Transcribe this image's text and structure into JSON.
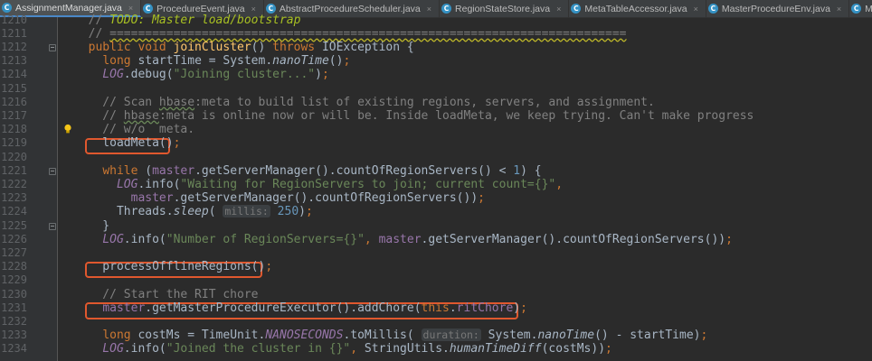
{
  "tabs": [
    {
      "label": "AssignmentManager.java",
      "active": true
    },
    {
      "label": "ProcedureEvent.java",
      "active": false
    },
    {
      "label": "AbstractProcedureScheduler.java",
      "active": false
    },
    {
      "label": "RegionStateStore.java",
      "active": false
    },
    {
      "label": "MetaTableAccessor.java",
      "active": false
    },
    {
      "label": "MasterProcedureEnv.java",
      "active": false
    },
    {
      "label": "MasterRpcServices.java",
      "active": false
    }
  ],
  "tab_icon_letter": "C",
  "lines": [
    {
      "num": "1210",
      "segs": [
        {
          "t": "  // ",
          "c": "cmt"
        },
        {
          "t": "TODO: Master load/bootstrap",
          "c": "todo"
        }
      ]
    },
    {
      "num": "1211",
      "segs": [
        {
          "t": "  // ",
          "c": "cmt"
        },
        {
          "t": "=========================================================================",
          "c": "dline"
        }
      ]
    },
    {
      "num": "1212",
      "segs": [
        {
          "t": "  ",
          "c": ""
        },
        {
          "t": "public void ",
          "c": "kw"
        },
        {
          "t": "joinCluster",
          "c": "fn"
        },
        {
          "t": "() ",
          "c": ""
        },
        {
          "t": "throws ",
          "c": "kw"
        },
        {
          "t": "IOException {",
          "c": ""
        }
      ]
    },
    {
      "num": "1213",
      "segs": [
        {
          "t": "    ",
          "c": ""
        },
        {
          "t": "long ",
          "c": "kw"
        },
        {
          "t": "startTime = System.",
          "c": ""
        },
        {
          "t": "nanoTime",
          "c": "itl"
        },
        {
          "t": "()",
          "c": ""
        },
        {
          "t": ";",
          "c": "kw"
        }
      ]
    },
    {
      "num": "1214",
      "segs": [
        {
          "t": "    ",
          "c": ""
        },
        {
          "t": "LOG",
          "c": "sfi"
        },
        {
          "t": ".debug(",
          "c": ""
        },
        {
          "t": "\"Joining cluster...\"",
          "c": "str"
        },
        {
          "t": ")",
          "c": ""
        },
        {
          "t": ";",
          "c": "kw"
        }
      ]
    },
    {
      "num": "1215",
      "segs": []
    },
    {
      "num": "1216",
      "segs": [
        {
          "t": "    // Scan ",
          "c": "cmt"
        },
        {
          "t": "hbase",
          "c": "cmt squig"
        },
        {
          "t": ":meta to build list of existing regions, servers, and assignment.",
          "c": "cmt"
        }
      ]
    },
    {
      "num": "1217",
      "segs": [
        {
          "t": "    // ",
          "c": "cmt"
        },
        {
          "t": "hbase",
          "c": "cmt squig"
        },
        {
          "t": ":meta is online now or will be. Inside loadMeta, we keep trying. Can't make progress",
          "c": "cmt"
        }
      ]
    },
    {
      "num": "1218",
      "segs": [
        {
          "t": "    // w/o  meta.",
          "c": "cmt"
        }
      ]
    },
    {
      "num": "1219",
      "segs": [
        {
          "t": "    loadMeta()",
          "c": ""
        },
        {
          "t": ";",
          "c": "kw"
        }
      ]
    },
    {
      "num": "1220",
      "segs": []
    },
    {
      "num": "1221",
      "segs": [
        {
          "t": "    ",
          "c": ""
        },
        {
          "t": "while ",
          "c": "kw"
        },
        {
          "t": "(",
          "c": ""
        },
        {
          "t": "master",
          "c": "fld"
        },
        {
          "t": ".getServerManager().countOfRegionServers() < ",
          "c": ""
        },
        {
          "t": "1",
          "c": "num"
        },
        {
          "t": ") {",
          "c": ""
        }
      ]
    },
    {
      "num": "1222",
      "segs": [
        {
          "t": "      ",
          "c": ""
        },
        {
          "t": "LOG",
          "c": "sfi"
        },
        {
          "t": ".info(",
          "c": ""
        },
        {
          "t": "\"Waiting for RegionServers to join; current count={}\"",
          "c": "str"
        },
        {
          "t": ",",
          "c": "kw"
        }
      ]
    },
    {
      "num": "1223",
      "segs": [
        {
          "t": "        ",
          "c": ""
        },
        {
          "t": "master",
          "c": "fld"
        },
        {
          "t": ".getServerManager().countOfRegionServers())",
          "c": ""
        },
        {
          "t": ";",
          "c": "kw"
        }
      ]
    },
    {
      "num": "1224",
      "segs": [
        {
          "t": "      Threads.",
          "c": ""
        },
        {
          "t": "sleep",
          "c": "itl"
        },
        {
          "t": "( ",
          "c": ""
        },
        {
          "t": "millis:",
          "c": "hint"
        },
        {
          "t": " ",
          "c": ""
        },
        {
          "t": "250",
          "c": "num"
        },
        {
          "t": ")",
          "c": ""
        },
        {
          "t": ";",
          "c": "kw"
        }
      ]
    },
    {
      "num": "1225",
      "segs": [
        {
          "t": "    }",
          "c": ""
        }
      ]
    },
    {
      "num": "1226",
      "segs": [
        {
          "t": "    ",
          "c": ""
        },
        {
          "t": "LOG",
          "c": "sfi"
        },
        {
          "t": ".info(",
          "c": ""
        },
        {
          "t": "\"Number of RegionServers={}\"",
          "c": "str"
        },
        {
          "t": ", ",
          "c": "kw"
        },
        {
          "t": "master",
          "c": "fld"
        },
        {
          "t": ".getServerManager().countOfRegionServers())",
          "c": ""
        },
        {
          "t": ";",
          "c": "kw"
        }
      ]
    },
    {
      "num": "1227",
      "segs": []
    },
    {
      "num": "1228",
      "segs": [
        {
          "t": "    processOfflineRegions()",
          "c": ""
        },
        {
          "t": ";",
          "c": "kw"
        }
      ]
    },
    {
      "num": "1229",
      "segs": []
    },
    {
      "num": "1230",
      "segs": [
        {
          "t": "    // Start the RIT chore",
          "c": "cmt"
        }
      ]
    },
    {
      "num": "1231",
      "segs": [
        {
          "t": "    ",
          "c": ""
        },
        {
          "t": "master",
          "c": "fld"
        },
        {
          "t": ".getMasterProcedureExecutor().addChore(",
          "c": ""
        },
        {
          "t": "this",
          "c": "kw"
        },
        {
          "t": ".",
          "c": ""
        },
        {
          "t": "ritChore",
          "c": "fld"
        },
        {
          "t": ")",
          "c": ""
        },
        {
          "t": ";",
          "c": "kw"
        }
      ]
    },
    {
      "num": "1232",
      "segs": []
    },
    {
      "num": "1233",
      "segs": [
        {
          "t": "    ",
          "c": ""
        },
        {
          "t": "long ",
          "c": "kw"
        },
        {
          "t": "costMs = TimeUnit.",
          "c": ""
        },
        {
          "t": "NANOSECONDS",
          "c": "sfi"
        },
        {
          "t": ".toMillis( ",
          "c": ""
        },
        {
          "t": "duration:",
          "c": "hint"
        },
        {
          "t": " System.",
          "c": ""
        },
        {
          "t": "nanoTime",
          "c": "itl"
        },
        {
          "t": "() - startTime)",
          "c": ""
        },
        {
          "t": ";",
          "c": "kw"
        }
      ]
    },
    {
      "num": "1234",
      "segs": [
        {
          "t": "    ",
          "c": ""
        },
        {
          "t": "LOG",
          "c": "sfi"
        },
        {
          "t": ".info(",
          "c": ""
        },
        {
          "t": "\"Joined the cluster in {}\"",
          "c": "str"
        },
        {
          "t": ", ",
          "c": "kw"
        },
        {
          "t": "StringUtils.",
          "c": ""
        },
        {
          "t": "humanTimeDiff",
          "c": "itl"
        },
        {
          "t": "(costMs))",
          "c": ""
        },
        {
          "t": ";",
          "c": "kw"
        }
      ]
    }
  ]
}
